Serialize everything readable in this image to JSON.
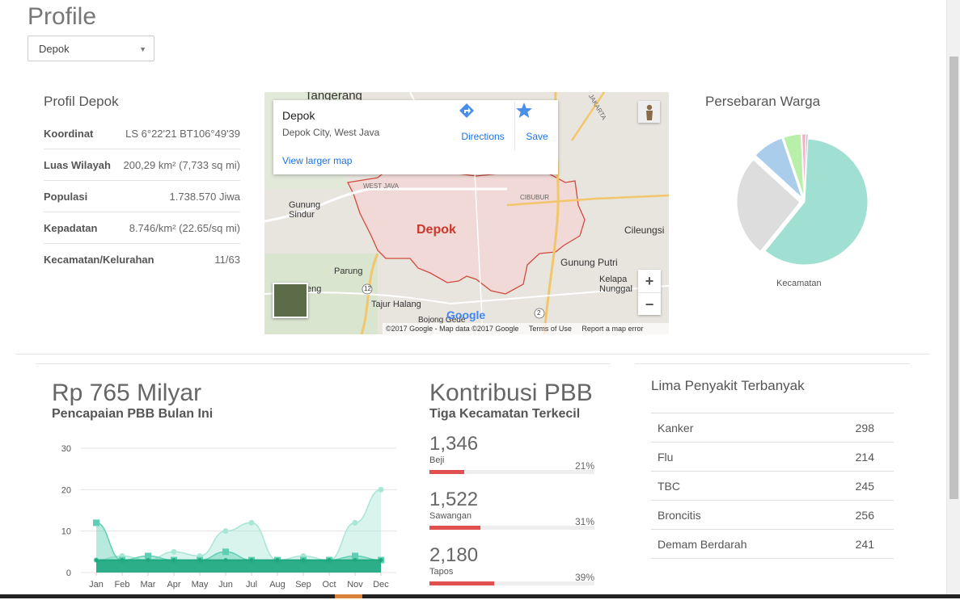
{
  "page_title": "Profile",
  "city_select": {
    "value": "Depok",
    "caret": "▼"
  },
  "profil": {
    "title": "Profil Depok",
    "rows": [
      {
        "key": "Koordinat",
        "value": "LS 6°22'21 BT106°49'39"
      },
      {
        "key": "Luas Wilayah",
        "value": "200,29 km² (7,733 sq mi)"
      },
      {
        "key": "Populasi",
        "value": "1.738.570 Jiwa"
      },
      {
        "key": "Kepadatan",
        "value": "8.746/km² (22.65/sq mi)"
      },
      {
        "key": "Kecamatan/Kelurahan",
        "value": "11/63"
      }
    ]
  },
  "map": {
    "place_name": "Depok",
    "place_address": "Depok City, West Java",
    "view_larger": "View larger map",
    "directions_label": "Directions",
    "save_label": "Save",
    "directions_icon": "directions-icon",
    "save_icon": "star-icon",
    "zoom_in": "+",
    "zoom_out": "−",
    "labels": {
      "tangerang": "Tangerang",
      "depok": "Depok",
      "west_java": "WEST JAVA",
      "cibubur": "CIBUBUR",
      "gunung_sindur": "Gunung\nSindur",
      "parung": "Parung",
      "cileungsi": "Cileungsi",
      "gunung_putri": "Gunung Putri",
      "kelapa_nunggal": "Kelapa\nNunggal",
      "tajur_halang": "Tajur Halang",
      "bojong_gede": "Bojong Gede",
      "seng": "eng",
      "jakarta": "JAKARTA",
      "road_12": "12",
      "road_2": "2"
    },
    "logo": "Google",
    "attribution": "©2017 Google - Map data ©2017 Google",
    "terms": "Terms of Use",
    "report": "Report a map error"
  },
  "persebaran": {
    "title": "Persebaran Warga",
    "label": "Kecamatan",
    "slice_colors": [
      "#9fe0d3",
      "#dddddd",
      "#a9cdea",
      "#b9f0a9",
      "#f4b3c2",
      "#c9b3e0"
    ]
  },
  "pbb": {
    "amount": "Rp 765 Milyar",
    "subtitle": "Pencapaian PBB Bulan Ini"
  },
  "chart_data": {
    "type": "area",
    "title": "",
    "xlabel": "",
    "ylabel": "",
    "ylim": [
      0,
      30
    ],
    "yticks": [
      0,
      10,
      20,
      30
    ],
    "categories": [
      "Jan",
      "Feb",
      "Mar",
      "Apr",
      "May",
      "Jun",
      "Jul",
      "Aug",
      "Sep",
      "Oct",
      "Nov",
      "Dec"
    ],
    "series": [
      {
        "color": "#a8e6d6",
        "values": [
          3,
          4,
          3,
          5,
          4,
          10,
          12,
          3,
          4,
          3,
          12,
          20
        ]
      },
      {
        "color": "#5fcfb3",
        "values": [
          12,
          3,
          4,
          3,
          3,
          5,
          3,
          3,
          3,
          3,
          4,
          3
        ]
      },
      {
        "color": "#1fa87f",
        "values": [
          3,
          3,
          3,
          3,
          3,
          3,
          3,
          3,
          3,
          3,
          3,
          3
        ]
      }
    ]
  },
  "kontribusi": {
    "title": "Kontribusi PBB",
    "subtitle": "Tiga Kecamatan Terkecil",
    "items": [
      {
        "value": "1,346",
        "name": "Beji",
        "percent": "21%",
        "fill": 0.21
      },
      {
        "value": "1,522",
        "name": "Sawangan",
        "percent": "31%",
        "fill": 0.31
      },
      {
        "value": "2,180",
        "name": "Tapos",
        "percent": "39%",
        "fill": 0.39
      }
    ]
  },
  "penyakit": {
    "title": "Lima Penyakit Terbanyak",
    "rows": [
      {
        "name": "Kanker",
        "count": "298"
      },
      {
        "name": "Flu",
        "count": "214"
      },
      {
        "name": "TBC",
        "count": "245"
      },
      {
        "name": "Broncitis",
        "count": "256"
      },
      {
        "name": "Demam Berdarah",
        "count": "241"
      }
    ]
  }
}
